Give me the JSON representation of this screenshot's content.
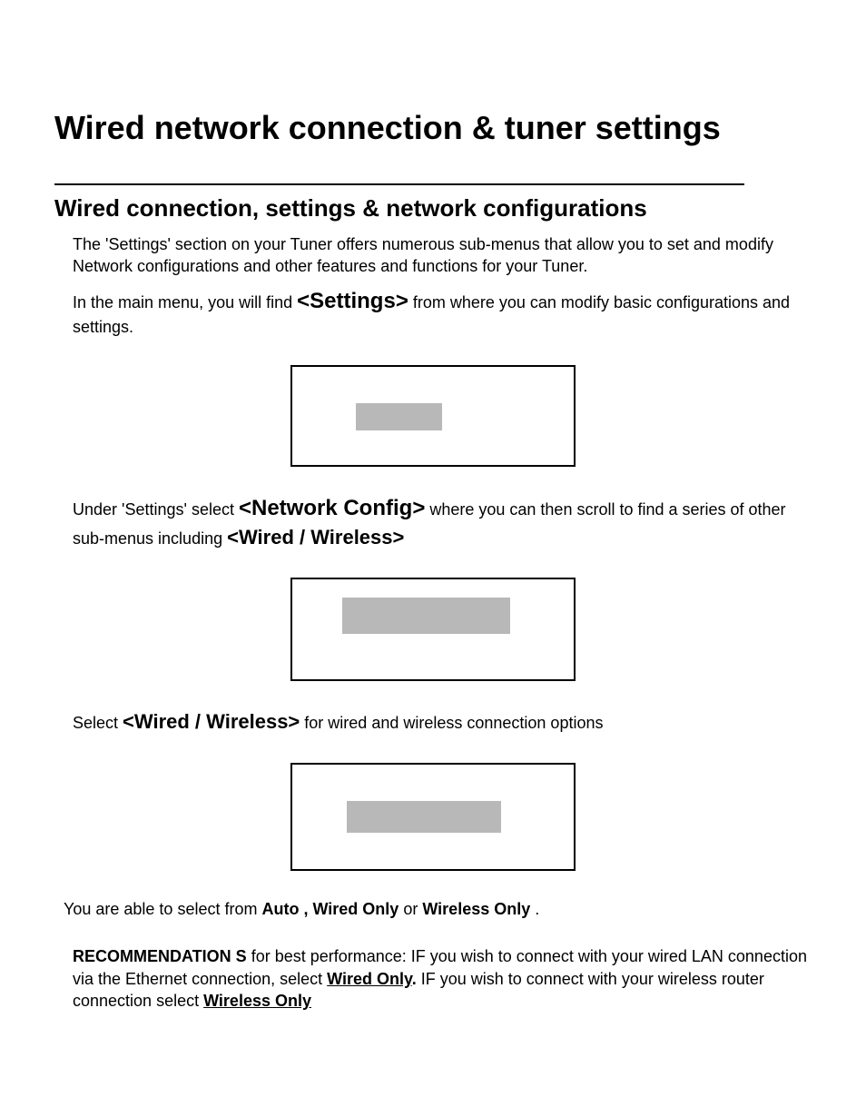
{
  "title": "Wired network connection & tuner settings",
  "subtitle": "Wired connection, settings & network configurations",
  "intro": "The 'Settings' section on your Tuner offers numerous sub-menus that allow you to set and modify Network configurations and other features and functions for your Tuner.",
  "para2": {
    "pre": "In the main menu, you will find ",
    "kw": "<Settings>",
    "post": "  from where you can modify basic configurations and settings."
  },
  "para3": {
    "pre": "Under 'Settings' select ",
    "kw1": "<Network Config>",
    "mid": "  where you can then scroll to find a series of other sub-menus including ",
    "kw2": "<Wired / Wireless>"
  },
  "para4": {
    "pre": "Select ",
    "kw": "<Wired / Wireless>",
    "post": " for wired and wireless connection options"
  },
  "selectLine": {
    "pre": "You are able to select from ",
    "opt1": "Auto , Wired  Only",
    "mid": " or ",
    "opt2": "Wireless Only",
    "post": "."
  },
  "rec": {
    "title": "RECOMMENDATION S",
    "a1": "  for best performance:  IF you wish to connect with your wired LAN connection via the Ethernet connection, select ",
    "u1": "Wired Only",
    "u1p": ".",
    "a2": "  IF you wish to connect with your wireless router connection select ",
    "u2": "Wireless Only"
  }
}
